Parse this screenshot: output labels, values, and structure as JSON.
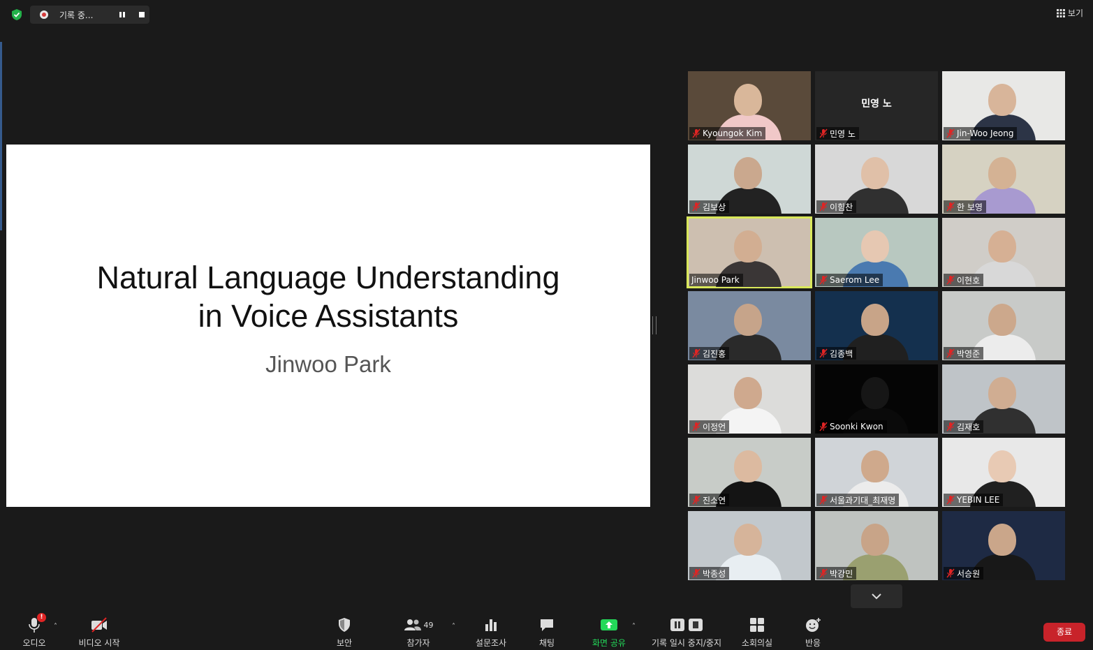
{
  "recording": {
    "status": "기록 중..."
  },
  "view": {
    "label": "보기"
  },
  "slide": {
    "title_line1": "Natural Language Understanding",
    "title_line2": "in Voice Assistants",
    "presenter": "Jinwoo Park"
  },
  "participants": [
    {
      "name": "Kyoungok Kim",
      "muted": true,
      "bg": "#5a4a3a",
      "skin": "#d9b79a",
      "shirt": "#f0c8c8"
    },
    {
      "name": "민영 노",
      "muted": true,
      "video": false,
      "display": "민영 노"
    },
    {
      "name": "Jin-Woo Jeong",
      "muted": true,
      "bg": "#e8e8e6",
      "skin": "#d8b59a",
      "shirt": "#2c3446"
    },
    {
      "name": "김보상",
      "muted": true,
      "bg": "#cfd8d6",
      "skin": "#caa88e",
      "shirt": "#222222"
    },
    {
      "name": "이힘찬",
      "muted": true,
      "bg": "#d8d8d8",
      "skin": "#e0c0a8",
      "shirt": "#303030"
    },
    {
      "name": "한 보영",
      "muted": true,
      "bg": "#d6d2c2",
      "skin": "#d4b294",
      "shirt": "#a89ad0"
    },
    {
      "name": "Jinwoo Park",
      "muted": false,
      "active": true,
      "bg": "#cdbfb0",
      "skin": "#d2ae92",
      "shirt": "#3a3636"
    },
    {
      "name": "Saerom Lee",
      "muted": true,
      "bg": "#b8c8c0",
      "skin": "#e6c8b2",
      "shirt": "#4a7ab0"
    },
    {
      "name": "이현호",
      "muted": true,
      "bg": "#d0cdc8",
      "skin": "#d6b094",
      "shirt": "#d8d8d8"
    },
    {
      "name": "김진홍",
      "muted": true,
      "bg": "#7a8aa0",
      "skin": "#c6a48a",
      "shirt": "#2a2a2a"
    },
    {
      "name": "김종백",
      "muted": true,
      "bg": "#14304e",
      "skin": "#c8a488",
      "shirt": "#202020"
    },
    {
      "name": "박영준",
      "muted": true,
      "bg": "#c8cac8",
      "skin": "#cca88c",
      "shirt": "#ececec"
    },
    {
      "name": "이정언",
      "muted": true,
      "bg": "#dcdcda",
      "skin": "#cfa98e",
      "shirt": "#f4f4f4"
    },
    {
      "name": "Soonki Kwon",
      "muted": true,
      "bg": "#050505",
      "skin": "#161616",
      "shirt": "#0a0a0a"
    },
    {
      "name": "김재호",
      "muted": true,
      "bg": "#bfc4c8",
      "skin": "#d0ad92",
      "shirt": "#303030"
    },
    {
      "name": "진소연",
      "muted": true,
      "bg": "#c8ccc8",
      "skin": "#dcbaa0",
      "shirt": "#141414"
    },
    {
      "name": "서울과기대_최재명",
      "muted": true,
      "bg": "#d0d4d8",
      "skin": "#cfa98c",
      "shirt": "#ececec"
    },
    {
      "name": "YEBIN LEE",
      "muted": true,
      "bg": "#e8e8e8",
      "skin": "#e8cab4",
      "shirt": "#202020"
    },
    {
      "name": "박종성",
      "muted": true,
      "bg": "#c2c8cc",
      "skin": "#d6b49a",
      "shirt": "#e8eef2"
    },
    {
      "name": "박강민",
      "muted": true,
      "bg": "#bfc3c0",
      "skin": "#c8a488",
      "shirt": "#9aa070"
    },
    {
      "name": "서승원",
      "muted": true,
      "bg": "#1e2a44",
      "skin": "#caa68a",
      "shirt": "#181818"
    }
  ],
  "toolbar": {
    "audio": "오디오",
    "video": "비디오 시작",
    "security": "보안",
    "participants": "참가자",
    "participant_count": "49",
    "polls": "설문조사",
    "chat": "채팅",
    "share": "화면 공유",
    "record": "기록 일시 중지/중지",
    "breakout": "소회의실",
    "reactions": "반응",
    "end": "종료",
    "audio_badge": "!"
  },
  "colors": {
    "accent_green": "#23d959",
    "end_red": "#c8232a",
    "active_border": "#d9e85a",
    "mute_red": "#e02424"
  }
}
